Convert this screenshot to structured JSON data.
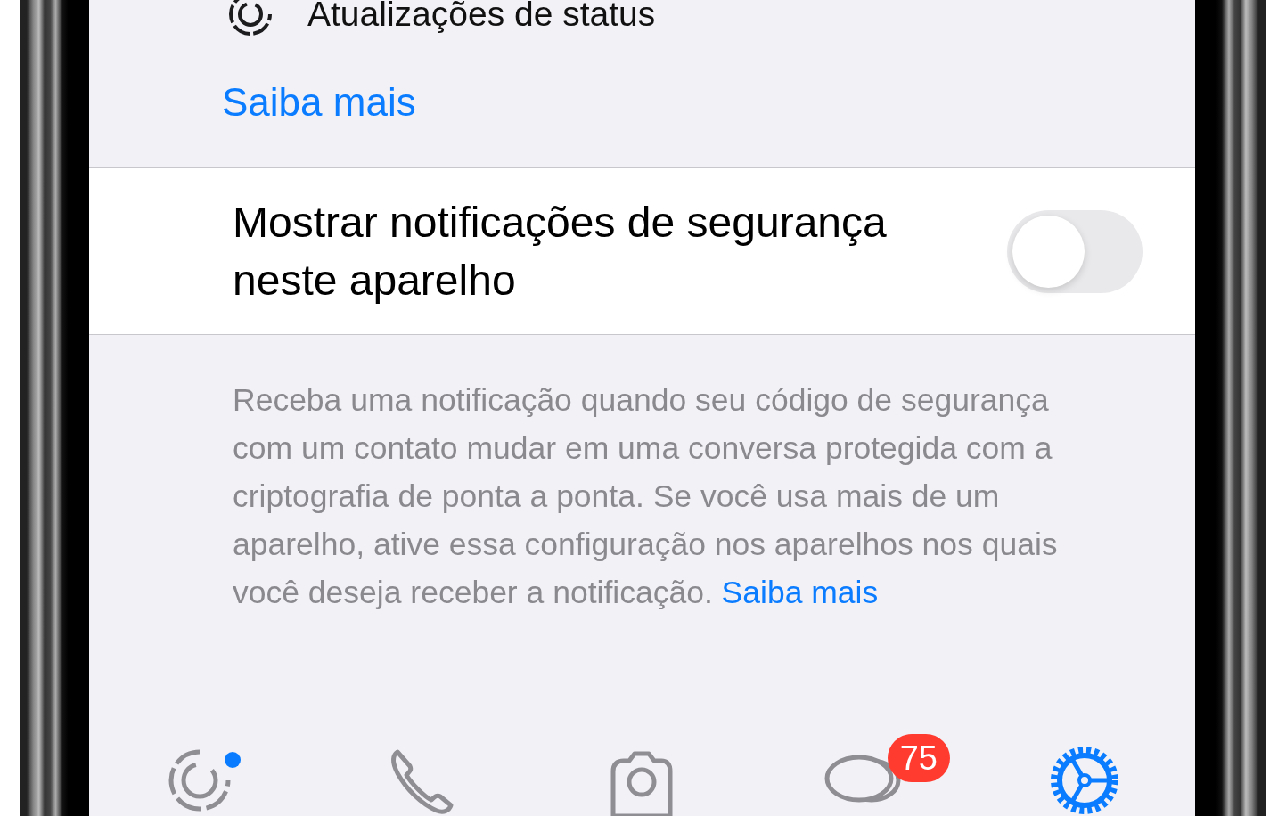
{
  "status_row": {
    "label": "Atualizações de status"
  },
  "learn_more_link": "Saiba mais",
  "security_setting": {
    "label": "Mostrar notificações de segurança neste aparelho",
    "on": false
  },
  "footer": {
    "text": "Receba uma notificação quando seu código de segurança com um contato mudar em uma conversa protegida com a criptografia de ponta a ponta. Se você usa mais de um aparelho, ative essa configuração nos aparelhos nos quais você deseja receber a notificação.",
    "link": "Saiba mais"
  },
  "tab_bar": [
    {
      "kind": "status",
      "selected": false,
      "dot": true
    },
    {
      "kind": "calls",
      "selected": false,
      "dot": false
    },
    {
      "kind": "camera",
      "selected": false,
      "dot": false
    },
    {
      "kind": "chats",
      "selected": false,
      "dot": false,
      "badge": "75"
    },
    {
      "kind": "settings",
      "selected": true,
      "dot": false
    }
  ]
}
